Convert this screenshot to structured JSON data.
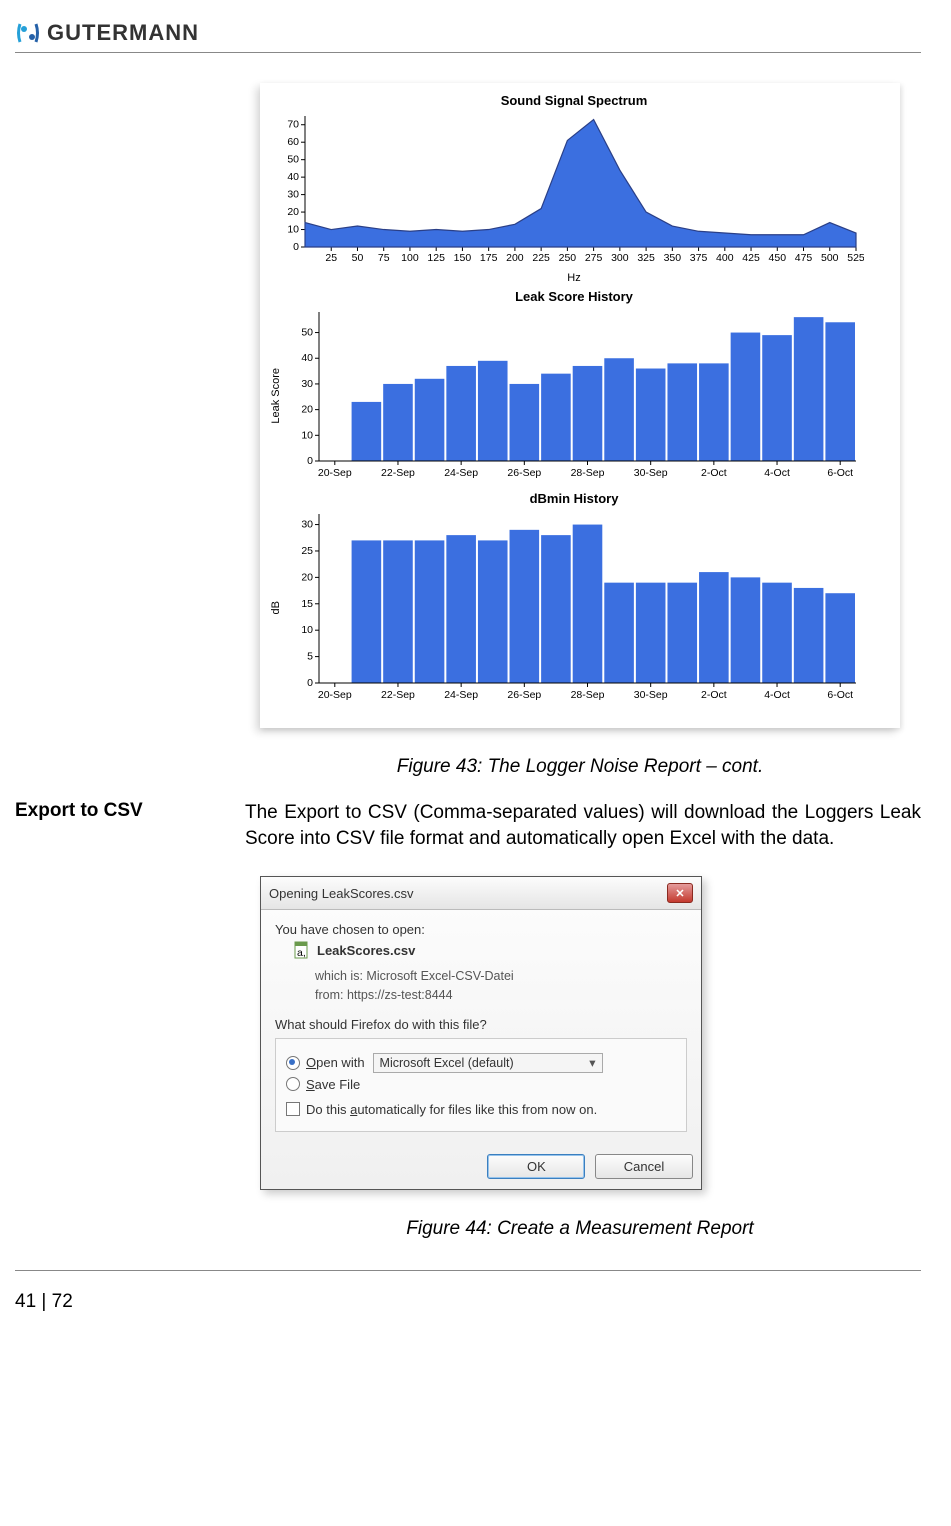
{
  "header": {
    "brand": "GUTERMANN"
  },
  "chart_data": [
    {
      "type": "area",
      "title": "Sound Signal Spectrum",
      "xlabel": "Hz",
      "ylabel": "",
      "x_ticks": [
        25,
        50,
        75,
        100,
        125,
        150,
        175,
        200,
        225,
        250,
        275,
        300,
        325,
        350,
        375,
        400,
        425,
        450,
        475,
        500,
        525
      ],
      "y_ticks": [
        0,
        10,
        20,
        30,
        40,
        50,
        60,
        70
      ],
      "xlim": [
        0,
        525
      ],
      "ylim": [
        0,
        75
      ],
      "x": [
        0,
        25,
        50,
        75,
        100,
        125,
        150,
        175,
        200,
        225,
        250,
        275,
        300,
        325,
        350,
        375,
        400,
        425,
        450,
        475,
        500,
        525
      ],
      "values": [
        14,
        10,
        12,
        10,
        9,
        10,
        9,
        10,
        13,
        22,
        61,
        73,
        44,
        20,
        12,
        9,
        8,
        7,
        7,
        7,
        14,
        8
      ]
    },
    {
      "type": "bar",
      "title": "Leak Score History",
      "xlabel": "",
      "ylabel": "Leak Score",
      "categories": [
        "20-Sep",
        "21-Sep",
        "22-Sep",
        "23-Sep",
        "24-Sep",
        "25-Sep",
        "26-Sep",
        "27-Sep",
        "28-Sep",
        "29-Sep",
        "30-Sep",
        "1-Oct",
        "2-Oct",
        "3-Oct",
        "4-Oct",
        "5-Oct",
        "6-Oct"
      ],
      "x_ticks": [
        "20-Sep",
        "22-Sep",
        "24-Sep",
        "26-Sep",
        "28-Sep",
        "30-Sep",
        "2-Oct",
        "4-Oct",
        "6-Oct"
      ],
      "y_ticks": [
        0,
        10,
        20,
        30,
        40,
        50
      ],
      "ylim": [
        0,
        58
      ],
      "values": [
        0,
        23,
        30,
        32,
        37,
        39,
        30,
        34,
        37,
        40,
        36,
        38,
        38,
        50,
        49,
        56,
        54
      ]
    },
    {
      "type": "bar",
      "title": "dBmin History",
      "xlabel": "",
      "ylabel": "dB",
      "categories": [
        "20-Sep",
        "21-Sep",
        "22-Sep",
        "23-Sep",
        "24-Sep",
        "25-Sep",
        "26-Sep",
        "27-Sep",
        "28-Sep",
        "29-Sep",
        "30-Sep",
        "1-Oct",
        "2-Oct",
        "3-Oct",
        "4-Oct",
        "5-Oct",
        "6-Oct"
      ],
      "x_ticks": [
        "20-Sep",
        "22-Sep",
        "24-Sep",
        "26-Sep",
        "28-Sep",
        "30-Sep",
        "2-Oct",
        "4-Oct",
        "6-Oct"
      ],
      "y_ticks": [
        0,
        5,
        10,
        15,
        20,
        25,
        30
      ],
      "ylim": [
        0,
        32
      ],
      "values": [
        0,
        27,
        27,
        27,
        28,
        27,
        29,
        28,
        30,
        19,
        19,
        19,
        21,
        20,
        19,
        18,
        17
      ]
    }
  ],
  "caption1": "Figure 43: The Logger Noise Report – cont.",
  "section": {
    "heading": "Export to CSV",
    "text": "The Export to CSV (Comma-separated values) will download the Loggers Leak Score into CSV file format and automatically open Excel with the data."
  },
  "dialog": {
    "title": "Opening LeakScores.csv",
    "intro": "You have chosen to open:",
    "filename": "LeakScores.csv",
    "which_is_label": "which is:",
    "which_is_value": "Microsoft Excel-CSV-Datei",
    "from_label": "from:",
    "from_value": "https://zs-test:8444",
    "question": "What should Firefox do with this file?",
    "open_with": "Open with",
    "open_with_value": "Microsoft Excel (default)",
    "save_file": "Save File",
    "auto": "Do this automatically for files like this from now on.",
    "ok": "OK",
    "cancel": "Cancel"
  },
  "caption2": "Figure 44: Create a Measurement Report",
  "footer": {
    "page": "41 | 72"
  }
}
